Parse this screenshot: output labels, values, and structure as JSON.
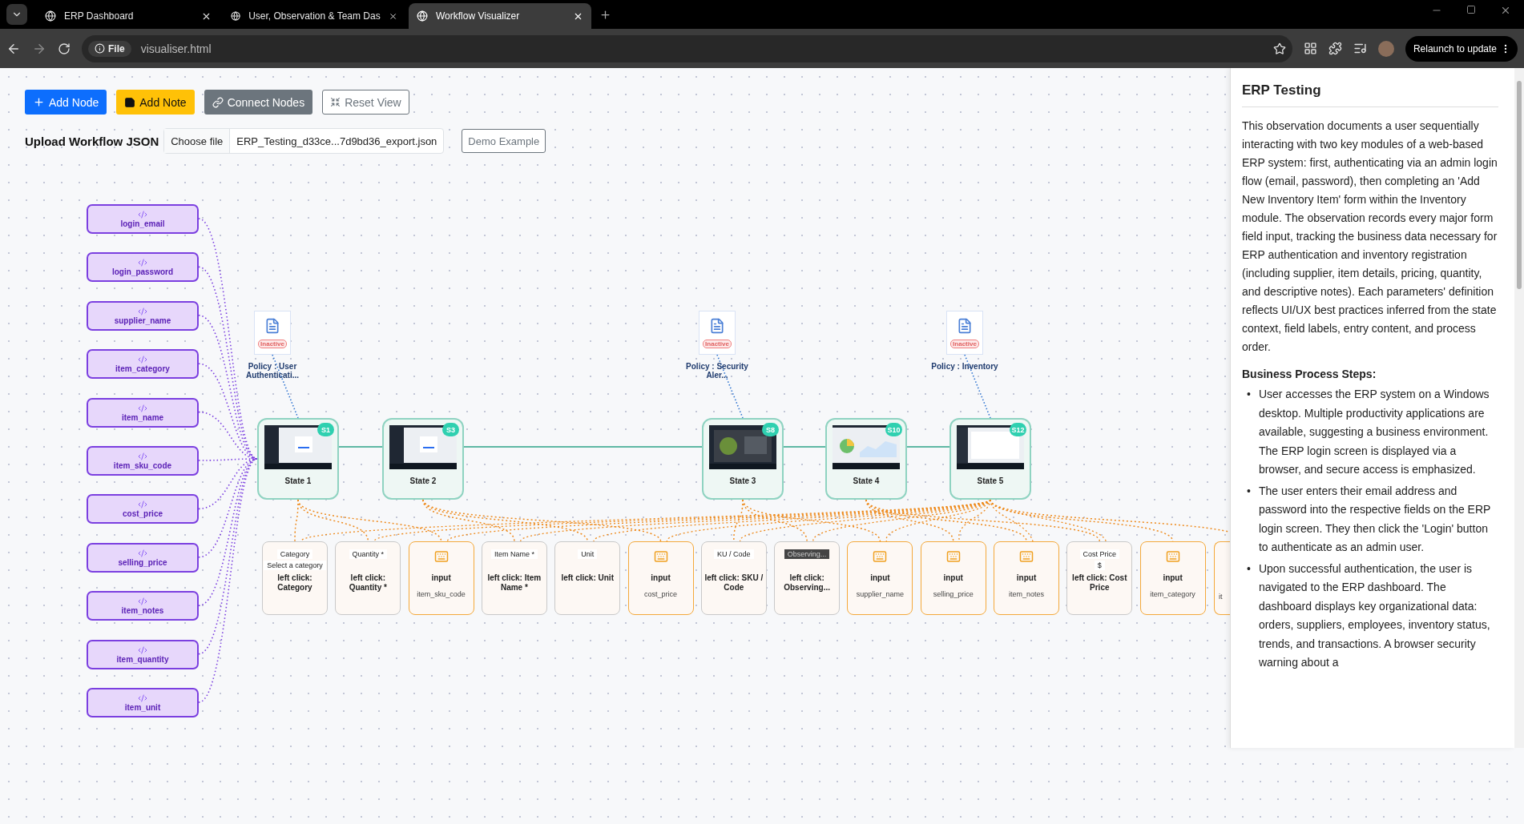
{
  "browser": {
    "tabs": [
      {
        "title": "ERP Dashboard",
        "selected": false
      },
      {
        "title": "User, Observation & Team Das",
        "selected": false
      },
      {
        "title": "Workflow Visualizer",
        "selected": true
      }
    ],
    "address": {
      "scheme": "File",
      "url": "visualiser.html"
    },
    "relaunch_button": "Relaunch to update"
  },
  "toolbar": {
    "buttons": [
      {
        "kind": "add_node",
        "label": "Add Node"
      },
      {
        "kind": "add_note",
        "label": "Add Note"
      },
      {
        "kind": "connect",
        "label": "Connect Nodes"
      },
      {
        "kind": "reset",
        "label": "Reset View"
      }
    ]
  },
  "upload": {
    "label": "Upload Workflow JSON",
    "choose_button": "Choose file",
    "file_name": "ERP_Testing_d33ce...7d9bd36_export.json",
    "demo_button": "Demo Example"
  },
  "parameters": [
    "login_email",
    "login_password",
    "supplier_name",
    "item_category",
    "item_name",
    "item_sku_code",
    "cost_price",
    "selling_price",
    "item_notes",
    "item_quantity",
    "item_unit"
  ],
  "states": [
    {
      "label": "State 1",
      "badge": "S1",
      "policy": {
        "title": "Policy : User Authenticati...",
        "status": "Inactive"
      }
    },
    {
      "label": "State 2",
      "badge": "S3"
    },
    {
      "label": "State 3",
      "badge": "S8",
      "policy": {
        "title": "Policy : Security Aler...",
        "status": "Inactive"
      }
    },
    {
      "label": "State 4",
      "badge": "S10"
    },
    {
      "label": "State 5",
      "badge": "S12",
      "policy": {
        "title": "Policy : Inventory",
        "status": "Inactive"
      }
    }
  ],
  "actions": [
    {
      "kind": "click",
      "snippet": [
        "Category",
        "Select a category"
      ],
      "label": "left click: Category"
    },
    {
      "kind": "click",
      "snippet": [
        "Quantity *"
      ],
      "label": "left click: Quantity *"
    },
    {
      "kind": "input",
      "label": "input",
      "field": "item_sku_code"
    },
    {
      "kind": "click",
      "snippet": [
        "Item Name *"
      ],
      "label": "left click: Item Name *"
    },
    {
      "kind": "click",
      "snippet": [
        "Unit"
      ],
      "label": "left click: Unit"
    },
    {
      "kind": "input",
      "label": "input",
      "field": "cost_price"
    },
    {
      "kind": "click",
      "snippet": [
        "KU / Code"
      ],
      "label": "left click: SKU / Code"
    },
    {
      "kind": "click",
      "snippet": [
        "Observing..."
      ],
      "dark_snippet": true,
      "label": "left click: Observing..."
    },
    {
      "kind": "input",
      "label": "input",
      "field": "supplier_name"
    },
    {
      "kind": "input",
      "label": "input",
      "field": "selling_price"
    },
    {
      "kind": "input",
      "label": "input",
      "field": "item_notes"
    },
    {
      "kind": "click",
      "snippet": [
        "Cost Price",
        "$"
      ],
      "label": "left click: Cost Price"
    },
    {
      "kind": "input",
      "label": "input",
      "field": "item_category"
    },
    {
      "kind": "partial",
      "field": "it"
    }
  ],
  "panel": {
    "title": "ERP Testing",
    "description": "This observation documents a user sequentially interacting with two key modules of a web-based ERP system: first, authenticating via an admin login flow (email, password), then completing an 'Add New Inventory Item' form within the Inventory module. The observation records every major form field input, tracking the business data necessary for ERP authentication and inventory registration (including supplier, item details, pricing, quantity, and descriptive notes). Each parameters' definition reflects UI/UX best practices inferred from the state context, field labels, entry content, and process order.",
    "steps_heading": "Business Process Steps:",
    "bullet": "•",
    "steps": [
      "User accesses the ERP system on a Windows desktop. Multiple productivity applications are available, suggesting a business environment. The ERP login screen is displayed via a browser, and secure access is emphasized.",
      "The user enters their email address and password into the respective fields on the ERP login screen. They then click the 'Login' button to authenticate as an admin user.",
      "Upon successful authentication, the user is navigated to the ERP dashboard. The dashboard displays key organizational data: orders, suppliers, employees, inventory status, trends, and transactions. A browser security warning about a"
    ]
  }
}
